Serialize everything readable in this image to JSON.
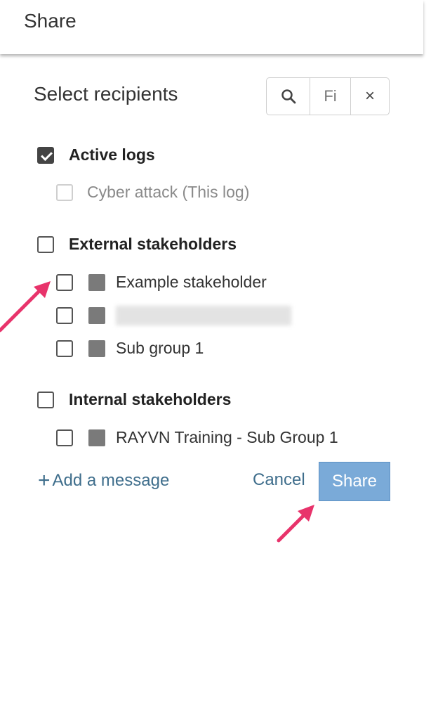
{
  "header": {
    "title": "Share"
  },
  "recipients": {
    "title": "Select recipients",
    "search_icon": "search-icon",
    "filter_placeholder": "Fi",
    "clear_label": "×"
  },
  "groups": [
    {
      "label": "Active logs",
      "checked": true,
      "items": [
        {
          "label": "Cyber attack (This log)",
          "disabled": true
        }
      ]
    },
    {
      "label": "External stakeholders",
      "checked": false,
      "items": [
        {
          "label": "Example stakeholder"
        },
        {
          "label": "",
          "redacted": true
        },
        {
          "label": "Sub group 1"
        }
      ]
    },
    {
      "label": "Internal stakeholders",
      "checked": false,
      "items": [
        {
          "label": "RAYVN Training - Sub Group 1"
        }
      ]
    }
  ],
  "actions": {
    "add_message_plus": "+",
    "add_message": "Add a message",
    "cancel": "Cancel",
    "share": "Share"
  },
  "colors": {
    "link": "#3f6e8c",
    "share_button": "#7aaad8",
    "annotation_arrow": "#e8336b"
  }
}
